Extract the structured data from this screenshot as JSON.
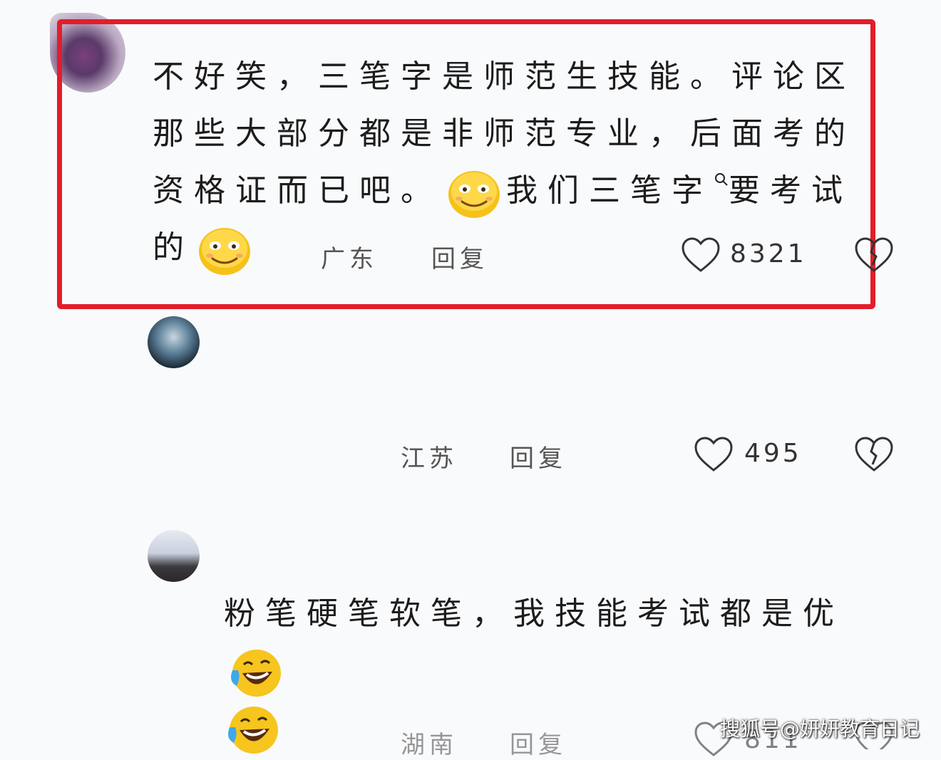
{
  "comments": [
    {
      "text_parts": [
        "不好笑，三笔字是师范生技能。评论区那些大部分都是非师范专业，后面考的资格证而已吧。",
        "我们三笔字",
        "要考试的"
      ],
      "location": "广东",
      "reply_label": "回复",
      "like_count": "8321",
      "highlighted": true,
      "emojis": [
        "smile-emoji",
        "search-icon",
        "smile-emoji"
      ]
    },
    {
      "text_parts": [],
      "location": "江苏",
      "reply_label": "回复",
      "like_count": "495",
      "highlighted": false
    },
    {
      "text_parts": [
        "粉笔硬笔软笔，我技能考试都是优"
      ],
      "location": "湖南",
      "reply_label": "回复",
      "like_count": "811",
      "highlighted": false,
      "emojis": [
        "laugh-cry-emoji",
        "laugh-cry-emoji"
      ]
    }
  ],
  "watermark": "搜狐号@妍妍教育日记",
  "colors": {
    "highlight_border": "#e31d2b",
    "background": "#f9fafc",
    "emoji_yellow": "#f5c21a"
  }
}
